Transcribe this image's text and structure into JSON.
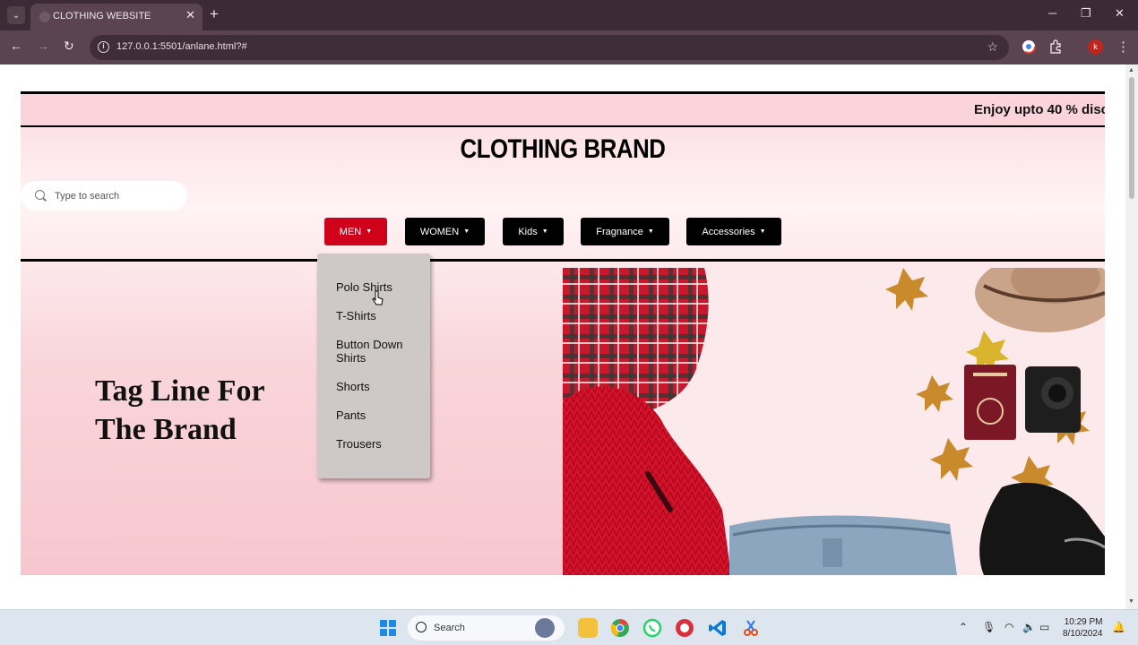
{
  "browser": {
    "tab_title": "CLOTHING WEBSITE",
    "url": "127.0.0.1:5501/anlane.html?#",
    "profile_initial": "k"
  },
  "site": {
    "marquee": "Enjoy upto 40 % disc",
    "brand": "CLOTHING BRAND",
    "search": {
      "placeholder": "Type to search"
    },
    "nav": [
      {
        "label": "MEN",
        "active": true
      },
      {
        "label": "WOMEN",
        "active": false
      },
      {
        "label": "Kids",
        "active": false
      },
      {
        "label": "Fragnance",
        "active": false
      },
      {
        "label": "Accessories",
        "active": false
      }
    ],
    "dropdown": [
      "Polo Shirts",
      "T-Shirts",
      "Button Down Shirts",
      "Shorts",
      "Pants",
      "Trousers"
    ],
    "tagline_line1": "Tag Line For",
    "tagline_line2": "The Brand"
  },
  "taskbar": {
    "search_label": "Search",
    "time": "10:29 PM",
    "date": "8/10/2024"
  },
  "colors": {
    "accent": "#d0021b",
    "chrome": "#5a4452",
    "hero_bg": "#fbd9de"
  }
}
